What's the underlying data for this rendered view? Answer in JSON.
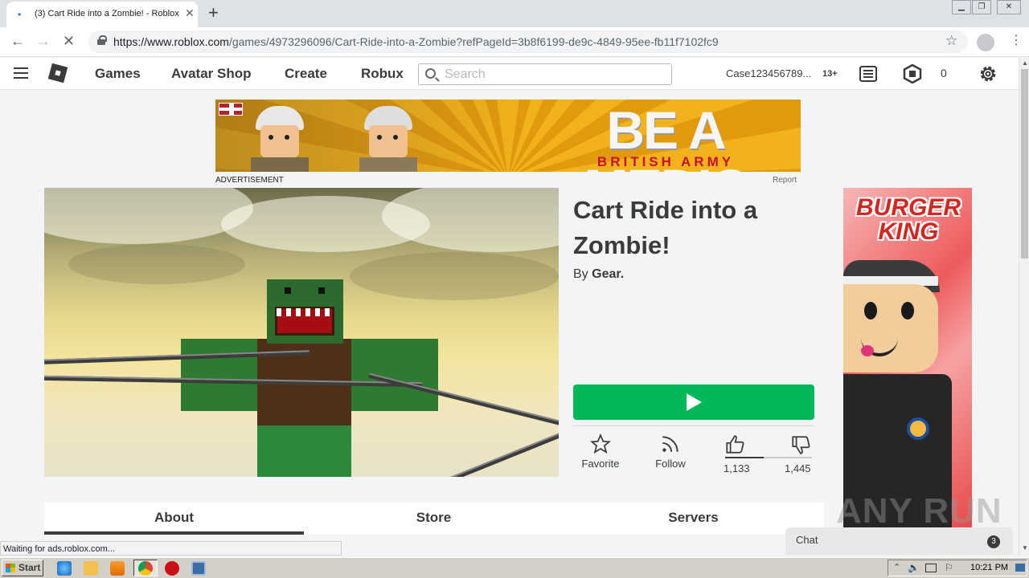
{
  "browser": {
    "tab_title": "(3) Cart Ride into a Zombie! - Roblox",
    "url_host": "https://www.roblox.com",
    "url_path": "/games/4973296096/Cart-Ride-into-a-Zombie?refPageId=3b8f6199-de9c-4849-95ee-fb11f7102fc9",
    "status_text": "Waiting for ads.roblox.com..."
  },
  "header": {
    "nav": [
      "Games",
      "Avatar Shop",
      "Create",
      "Robux"
    ],
    "search_placeholder": "Search",
    "username": "Case123456789...",
    "age_badge": "13+",
    "robux_balance": "0"
  },
  "ads": {
    "banner_headline": "BE A MEDIC",
    "banner_subline": "BRITISH ARMY",
    "advertisement_label": "ADVERTISEMENT",
    "report_label": "Report",
    "side_brand": "BURGER KING"
  },
  "game": {
    "title": "Cart Ride into a Zombie!",
    "by_label": "By",
    "creator": "Gear.",
    "favorite_label": "Favorite",
    "follow_label": "Follow",
    "upvotes": "1,133",
    "downvotes": "1,445",
    "upvote_fraction": 0.44
  },
  "tabs": [
    "About",
    "Store",
    "Servers"
  ],
  "chat": {
    "label": "Chat",
    "count": "3"
  },
  "watermark": "ANY RUN",
  "taskbar": {
    "start_label": "Start",
    "clock": "10:21 PM"
  },
  "colors": {
    "play_green": "#02b757",
    "text_dark": "#393b3d",
    "page_bg": "#f2f4f5"
  }
}
